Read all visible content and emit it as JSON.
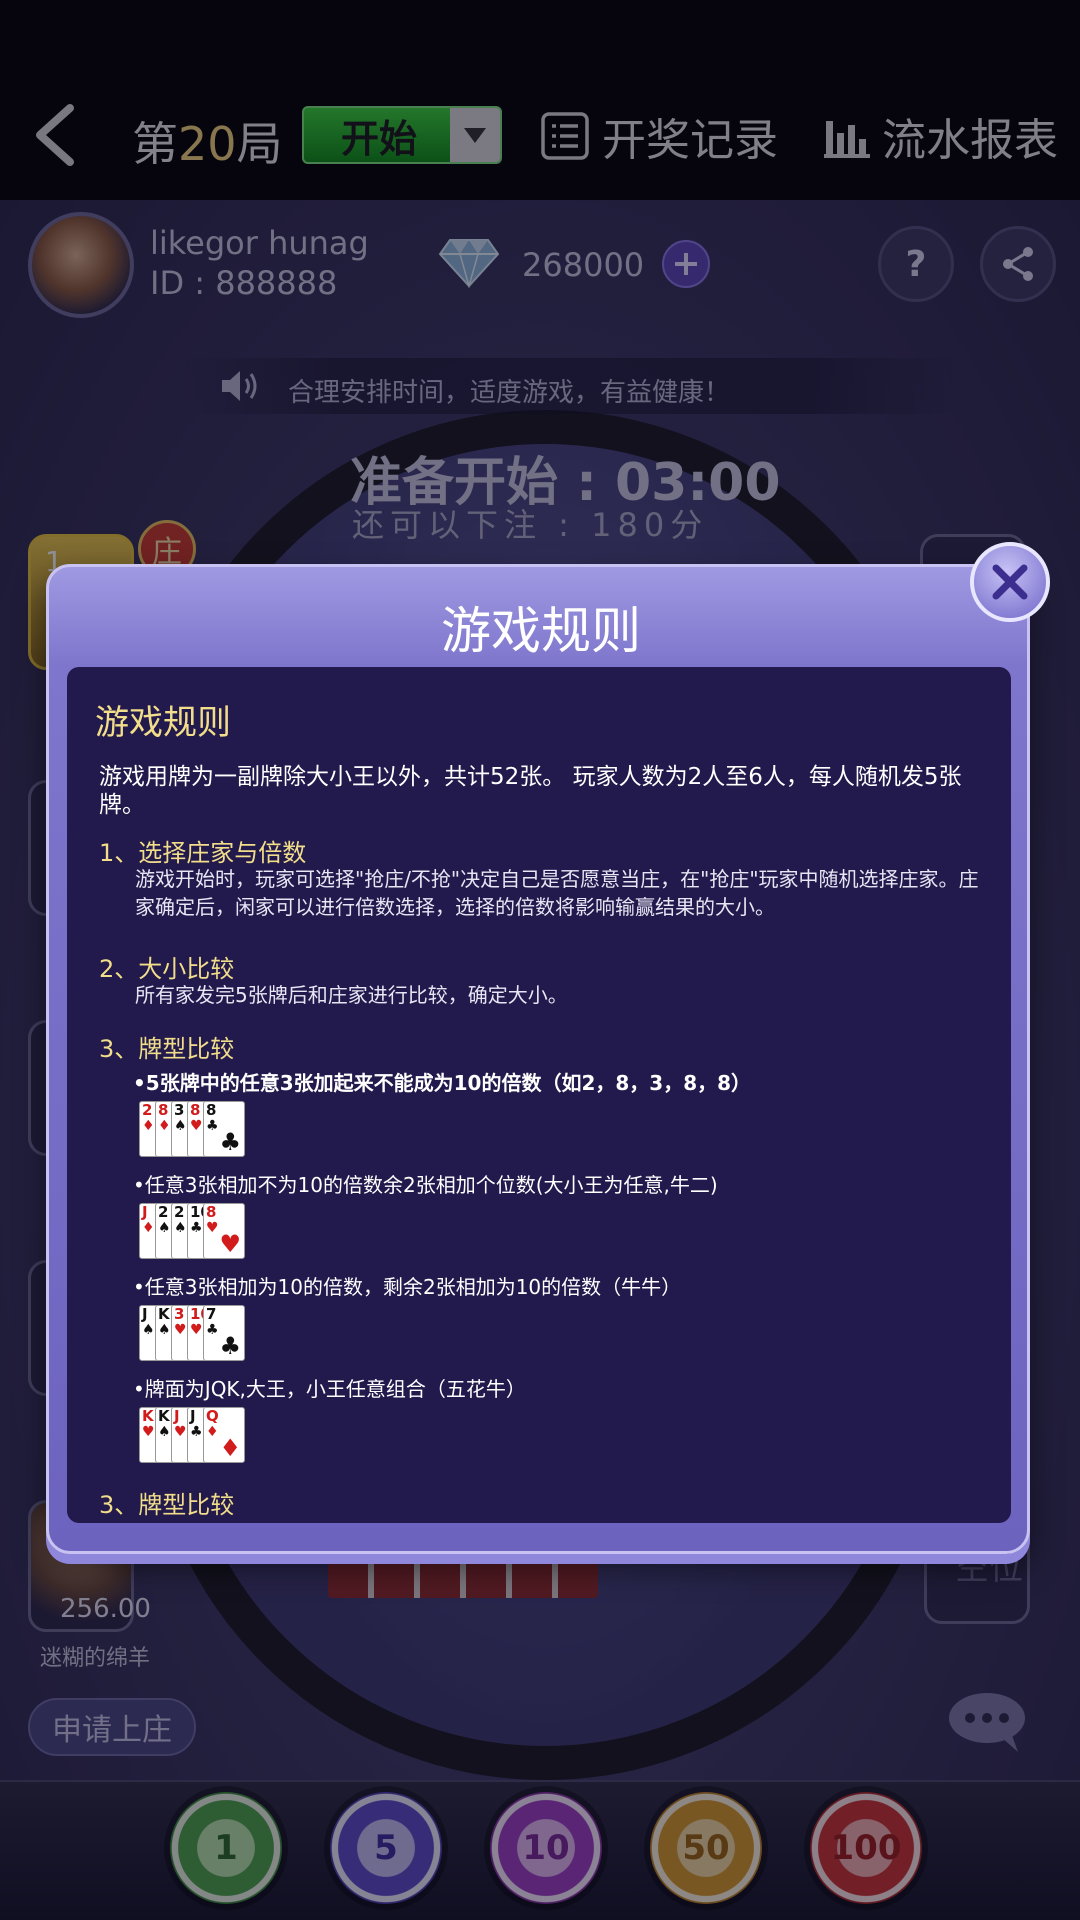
{
  "topbar": {
    "round_prefix": "第",
    "round_number": "20",
    "round_suffix": "局",
    "start_label": "开始",
    "history_label": "开奖记录",
    "report_label": "流水报表"
  },
  "user": {
    "name": "likegor hunag",
    "id": "ID : 888888",
    "balance": "268000"
  },
  "help_label": "?",
  "notice": "合理安排时间，适度游戏，有益健康！",
  "countdown": "准备开始 : 03:00",
  "bet_remaining": "还可以下注 : 180分",
  "banker_badge": "庄",
  "seat_banker_number": "1",
  "seat_score": "256.00",
  "seat_player_name": "迷糊的绵羊",
  "empty_seat": "空位",
  "apply_banker": "申请上庄",
  "chips": [
    "1",
    "5",
    "10",
    "50",
    "100"
  ],
  "modal": {
    "title": "游戏规则",
    "heading": "游戏规则",
    "intro": "游戏用牌为一副牌除大小王以外，共计52张。 玩家人数为2人至6人，每人随机发5张牌。",
    "sections": [
      {
        "title": "1、选择庄家与倍数",
        "text": "游戏开始时，玩家可选择\"抢庄/不抢\"决定自己是否愿意当庄，在\"抢庄\"玩家中随机选择庄家。庄家确定后，闲家可以进行倍数选择，选择的倍数将影响输赢结果的大小。"
      },
      {
        "title": "2、大小比较",
        "text": "所有家发完5张牌后和庄家进行比较，确定大小。"
      },
      {
        "title": "3、牌型比较",
        "bullets": [
          "•5张牌中的任意3张加起来不能成为10的倍数（如2，8，3，8，8）",
          "•任意3张相加不为10的倍数余2张相加个位数(大小王为任意,牛二)",
          "•任意3张相加为10的倍数，剩余2张相加为10的倍数（牛牛）",
          "•牌面为JQK,大王，小王任意组合（五花牛）"
        ]
      },
      {
        "title": "3、牌型比较"
      }
    ],
    "hands": [
      [
        {
          "r": "2",
          "s": "♦",
          "c": "red"
        },
        {
          "r": "8",
          "s": "♦",
          "c": "red"
        },
        {
          "r": "3",
          "s": "♠",
          "c": "blk"
        },
        {
          "r": "8",
          "s": "♥",
          "c": "red"
        },
        {
          "r": "8",
          "s": "♣",
          "c": "blk"
        }
      ],
      [
        {
          "r": "J",
          "s": "♦",
          "c": "red"
        },
        {
          "r": "2",
          "s": "♠",
          "c": "blk"
        },
        {
          "r": "2",
          "s": "♠",
          "c": "blk"
        },
        {
          "r": "10",
          "s": "♣",
          "c": "blk"
        },
        {
          "r": "8",
          "s": "♥",
          "c": "red"
        }
      ],
      [
        {
          "r": "J",
          "s": "♠",
          "c": "blk"
        },
        {
          "r": "K",
          "s": "♠",
          "c": "blk"
        },
        {
          "r": "3",
          "s": "♥",
          "c": "red"
        },
        {
          "r": "10",
          "s": "♥",
          "c": "red"
        },
        {
          "r": "7",
          "s": "♣",
          "c": "blk"
        }
      ],
      [
        {
          "r": "K",
          "s": "♥",
          "c": "red"
        },
        {
          "r": "K",
          "s": "♠",
          "c": "blk"
        },
        {
          "r": "J",
          "s": "♥",
          "c": "red"
        },
        {
          "r": "J",
          "s": "♣",
          "c": "blk"
        },
        {
          "r": "Q",
          "s": "♦",
          "c": "red"
        }
      ]
    ]
  },
  "colors": {
    "accent_gold": "#f2dd8a",
    "modal_panel": "#221a4c",
    "modal_frame": "#7e76cc"
  }
}
